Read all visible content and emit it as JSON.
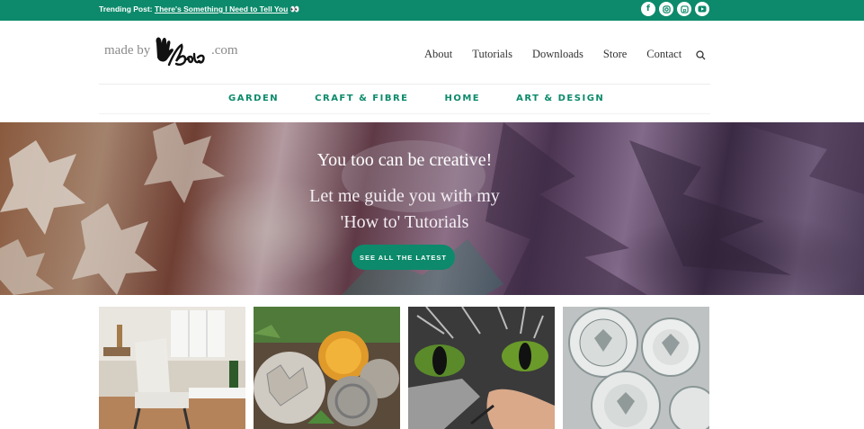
{
  "topbar": {
    "trending_label": "Trending Post:",
    "trending_link": "There's Something I Need to Tell You",
    "trending_emoji": "👀",
    "social_icons": [
      "facebook-icon",
      "instagram-icon",
      "pinterest-icon",
      "youtube-icon"
    ]
  },
  "brand": {
    "logo_prefix": "made by",
    "logo_suffix": ".com",
    "logo_script": "Barb"
  },
  "nav": {
    "items": [
      "About",
      "Tutorials",
      "Downloads",
      "Store",
      "Contact"
    ],
    "search_icon": "search-icon"
  },
  "categories": [
    "GARDEN",
    "CRAFT & FIBRE",
    "HOME",
    "ART & DESIGN"
  ],
  "hero": {
    "line1": "You too can be creative!",
    "line2": "Let me guide you with my",
    "line3": "'How to' Tutorials",
    "button": "SEE ALL THE LATEST"
  },
  "colors": {
    "accent": "#0c8a6b",
    "nav_text": "#333333",
    "logo_gray": "#8a8a8a"
  }
}
